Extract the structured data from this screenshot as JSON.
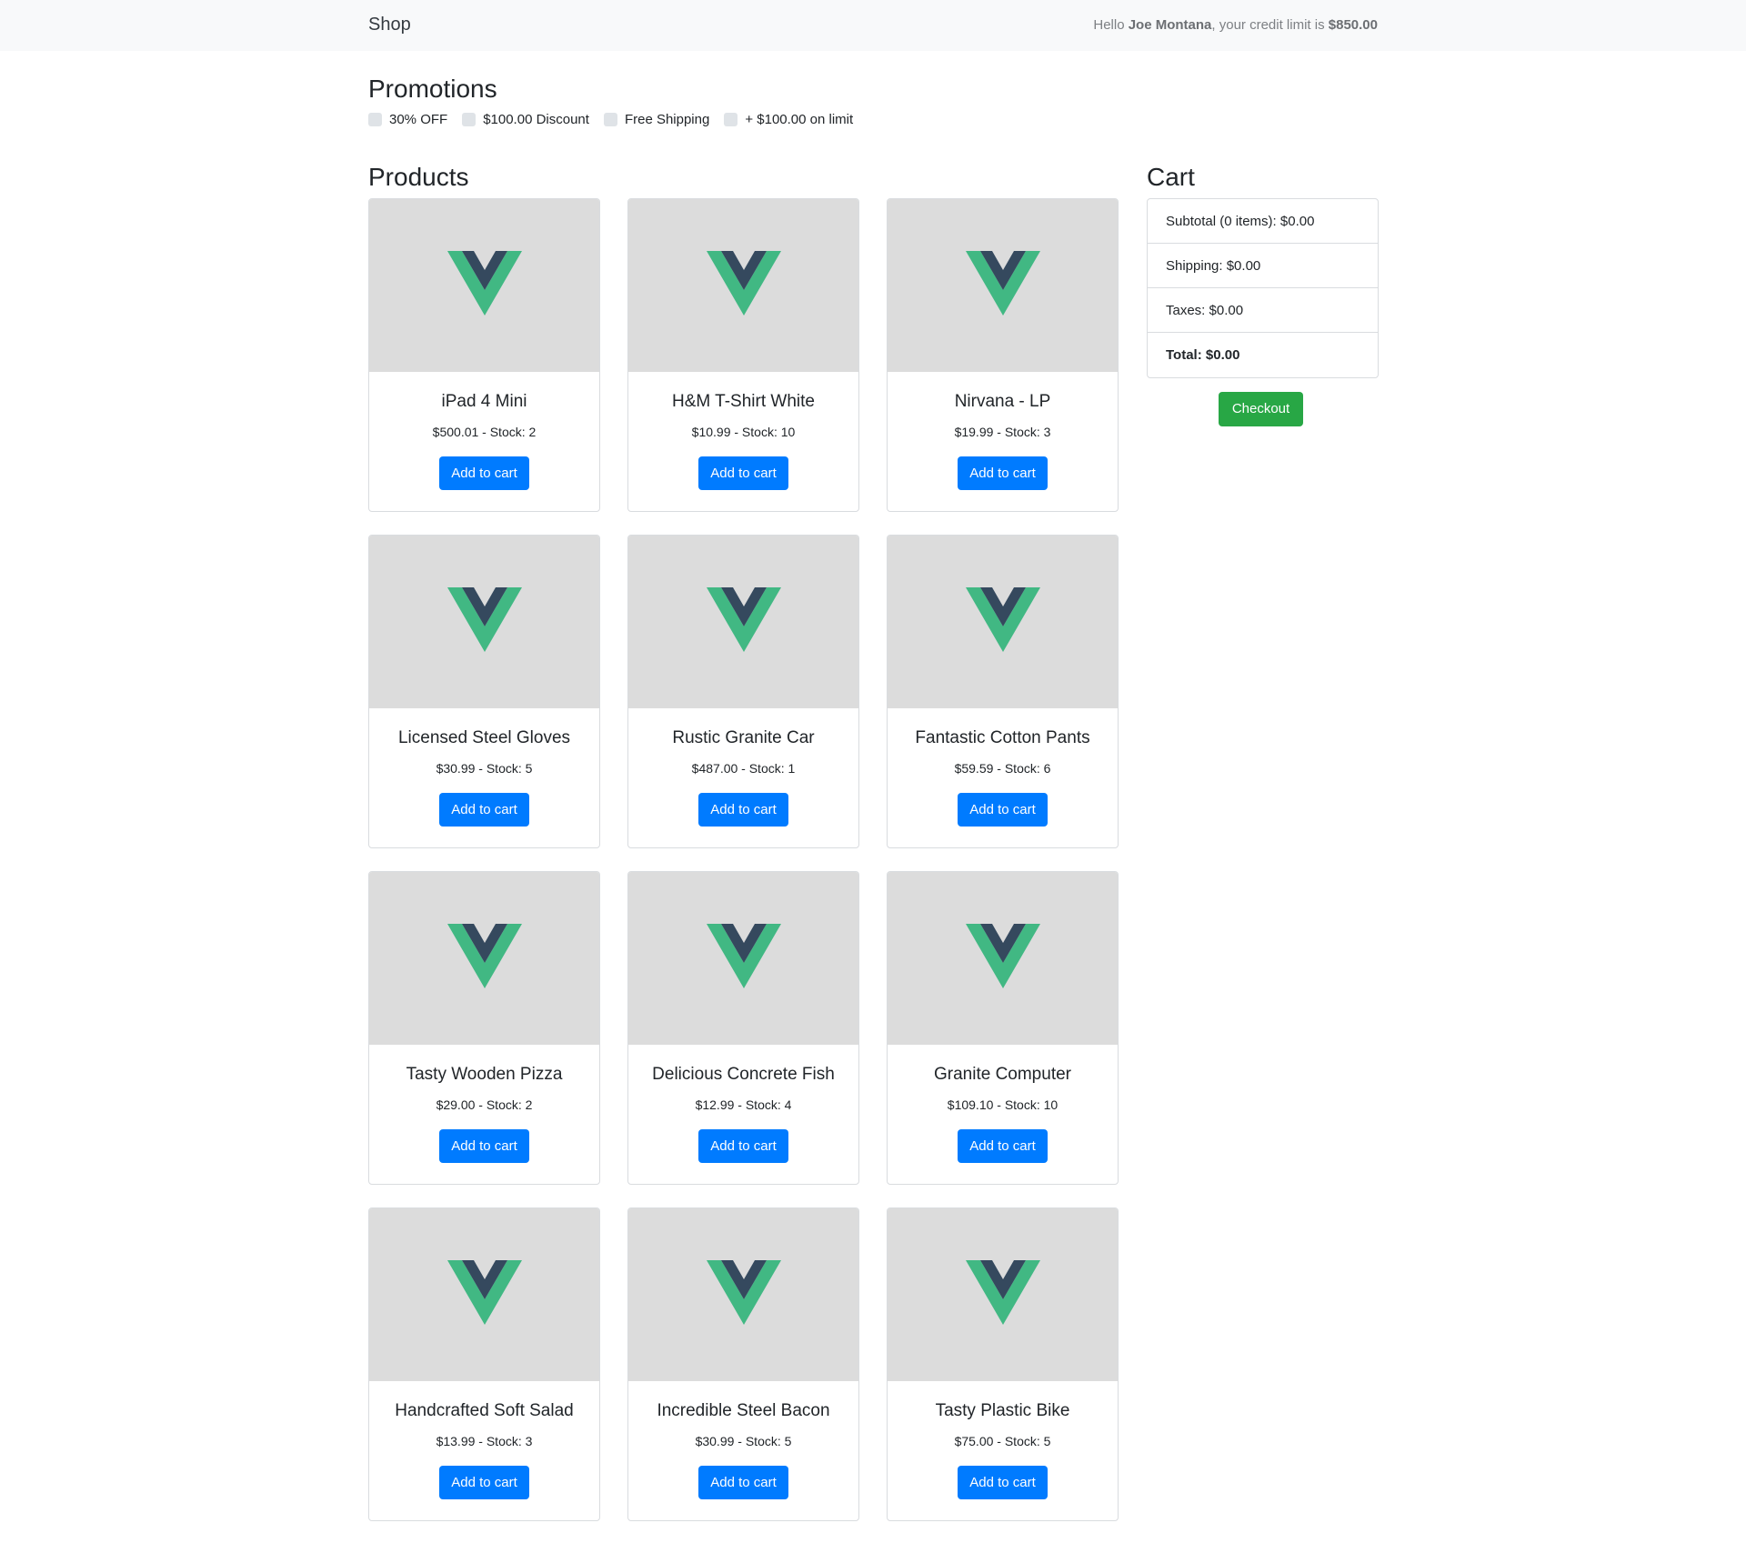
{
  "navbar": {
    "brand": "Shop",
    "greeting_prefix": "Hello ",
    "user_name": "Joe Montana",
    "greeting_middle": ", your credit limit is ",
    "credit_limit": "$850.00"
  },
  "promotions": {
    "title": "Promotions",
    "items": [
      {
        "label": "30% OFF",
        "checked": false
      },
      {
        "label": "$100.00 Discount",
        "checked": false
      },
      {
        "label": "Free Shipping",
        "checked": false
      },
      {
        "label": "+ $100.00 on limit",
        "checked": false
      }
    ]
  },
  "products": {
    "title": "Products",
    "button_label": "Add to cart",
    "items": [
      {
        "name": "iPad 4 Mini",
        "meta": "$500.01 - Stock: 2"
      },
      {
        "name": "H&M T-Shirt White",
        "meta": "$10.99 - Stock: 10"
      },
      {
        "name": "Nirvana - LP",
        "meta": "$19.99 - Stock: 3"
      },
      {
        "name": "Licensed Steel Gloves",
        "meta": "$30.99 - Stock: 5"
      },
      {
        "name": "Rustic Granite Car",
        "meta": "$487.00 - Stock: 1"
      },
      {
        "name": "Fantastic Cotton Pants",
        "meta": "$59.59 - Stock: 6"
      },
      {
        "name": "Tasty Wooden Pizza",
        "meta": "$29.00 - Stock: 2"
      },
      {
        "name": "Delicious Concrete Fish",
        "meta": "$12.99 - Stock: 4"
      },
      {
        "name": "Granite Computer",
        "meta": "$109.10 - Stock: 10"
      },
      {
        "name": "Handcrafted Soft Salad",
        "meta": "$13.99 - Stock: 3"
      },
      {
        "name": "Incredible Steel Bacon",
        "meta": "$30.99 - Stock: 5"
      },
      {
        "name": "Tasty Plastic Bike",
        "meta": "$75.00 - Stock: 5"
      }
    ]
  },
  "cart": {
    "title": "Cart",
    "subtotal": "Subtotal (0 items): $0.00",
    "shipping": "Shipping: $0.00",
    "taxes": "Taxes: $0.00",
    "total": "Total: $0.00",
    "checkout_label": "Checkout"
  },
  "colors": {
    "primary": "#007bff",
    "success": "#28a745",
    "vue_green": "#41b883",
    "vue_dark": "#35495e",
    "image_bg": "#dcdcdc"
  }
}
